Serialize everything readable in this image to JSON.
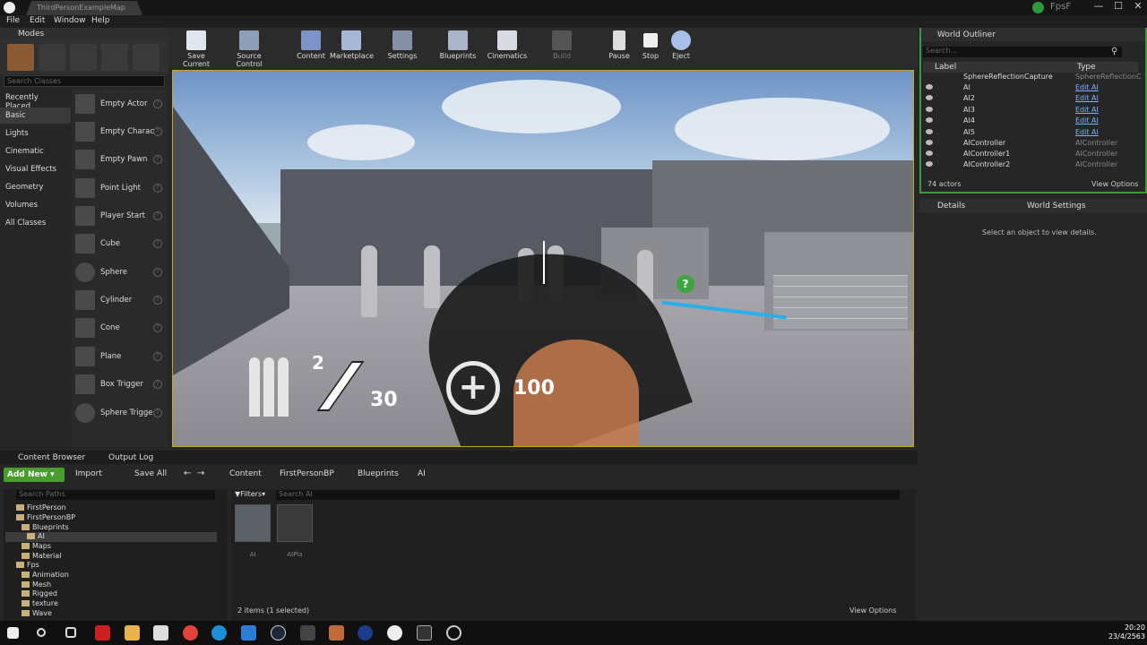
{
  "title_bar": {
    "tab_label": "ThirdPersonExampleMap",
    "project_name": "FpsF",
    "minimize": "—",
    "maximize": "☐",
    "close": "✕"
  },
  "menu": [
    "File",
    "Edit",
    "Window",
    "Help"
  ],
  "modes": {
    "header": "Modes",
    "search_placeholder": "Search Classes",
    "categories": [
      "Recently Placed",
      "Basic",
      "Lights",
      "Cinematic",
      "Visual Effects",
      "Geometry",
      "Volumes",
      "All Classes"
    ],
    "selected_category": "Basic",
    "items": [
      "Empty Actor",
      "Empty Charac",
      "Empty Pawn",
      "Point Light",
      "Player Start",
      "Cube",
      "Sphere",
      "Cylinder",
      "Cone",
      "Plane",
      "Box Trigger",
      "Sphere Trigge"
    ]
  },
  "toolbar": [
    "Save Current",
    "Source Control",
    "Content",
    "Marketplace",
    "Settings",
    "Blueprints",
    "Cinematics",
    "Build",
    "Pause",
    "Stop",
    "Eject"
  ],
  "hud": {
    "ammo_mag": "2",
    "ammo_reserve": "30",
    "health": "100",
    "marker_icon": "question-marker-icon"
  },
  "outliner": {
    "header": "World Outliner",
    "search_placeholder": "Search...",
    "col_label": "Label",
    "col_type": "Type",
    "rows": [
      {
        "label": "SphereReflectionCapture",
        "type": "SphereReflectionC"
      },
      {
        "label": "AI",
        "type": "Edit AI"
      },
      {
        "label": "AI2",
        "type": "Edit AI"
      },
      {
        "label": "AI3",
        "type": "Edit AI"
      },
      {
        "label": "AI4",
        "type": "Edit AI"
      },
      {
        "label": "AI5",
        "type": "Edit AI"
      },
      {
        "label": "AIController",
        "type": "AIController"
      },
      {
        "label": "AIController1",
        "type": "AIController"
      },
      {
        "label": "AIController2",
        "type": "AIController"
      }
    ],
    "actor_count": "74 actors",
    "view_options": "View Options"
  },
  "details": {
    "tab": "Details",
    "tab2": "World Settings",
    "empty_message": "Select an object to view details."
  },
  "content_browser": {
    "tab1": "Content Browser",
    "tab2": "Output Log",
    "add_new": "Add New",
    "import": "Import",
    "save_all": "Save All",
    "breadcrumb": [
      "Content",
      "FirstPersonBP",
      "Blueprints",
      "AI"
    ],
    "search_paths_placeholder": "Search Paths",
    "filters": "Filters",
    "search_assets_placeholder": "Search AI",
    "tree": [
      {
        "label": "FirstPerson",
        "indent": 0
      },
      {
        "label": "FirstPersonBP",
        "indent": 0
      },
      {
        "label": "Blueprints",
        "indent": 1
      },
      {
        "label": "AI",
        "indent": 2,
        "selected": true
      },
      {
        "label": "Maps",
        "indent": 1
      },
      {
        "label": "Material",
        "indent": 1
      },
      {
        "label": "Fps",
        "indent": 0
      },
      {
        "label": "Animation",
        "indent": 1
      },
      {
        "label": "Mesh",
        "indent": 1
      },
      {
        "label": "Rigged",
        "indent": 1
      },
      {
        "label": "texture",
        "indent": 1
      },
      {
        "label": "Wave",
        "indent": 1
      }
    ],
    "assets": [
      "AI",
      "AIPla"
    ],
    "item_count": "2 items (1 selected)",
    "view_options": "View Options"
  },
  "taskbar": {
    "time": "20:20",
    "date": "23/4/2563"
  }
}
